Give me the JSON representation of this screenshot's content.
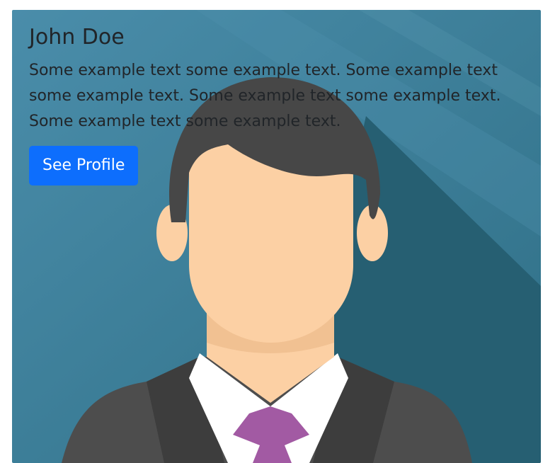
{
  "card": {
    "title": "John Doe",
    "text": "Some example text some example text. Some example text some example text. Some example text some example text. Some example text some example text.",
    "button_label": "See Profile"
  },
  "colors": {
    "background_teal": "#3f7f9b",
    "shadow": "#265f72",
    "hair": "#474747",
    "skin": "#fcd0a4",
    "suit": "#4d4d4d",
    "shirt": "#ffffff",
    "tie": "#a25aa3",
    "button": "#0d6efd",
    "text": "#212529"
  },
  "icons": {
    "avatar": "businessman-avatar-illustration"
  }
}
